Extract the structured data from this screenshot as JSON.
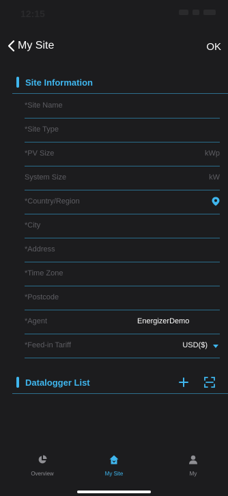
{
  "status": {
    "time": "12:15"
  },
  "nav": {
    "back_label": "My Site",
    "ok_label": "OK"
  },
  "site_info": {
    "title": "Site Information",
    "fields": {
      "site_name": {
        "label": "*Site Name"
      },
      "site_type": {
        "label": "*Site Type"
      },
      "pv_size": {
        "label": "*PV Size",
        "unit": "kWp"
      },
      "system_size": {
        "label": "System Size",
        "unit": "kW"
      },
      "country": {
        "label": "*Country/Region"
      },
      "city": {
        "label": "*City"
      },
      "address": {
        "label": "*Address"
      },
      "time_zone": {
        "label": "*Time Zone"
      },
      "postcode": {
        "label": "*Postcode"
      },
      "agent": {
        "label": "*Agent",
        "value": "EnergizerDemo"
      },
      "feed_in": {
        "label": "*Feed-in Tariff",
        "value": "USD($)"
      }
    }
  },
  "datalogger": {
    "title": "Datalogger List"
  },
  "tabs": {
    "overview": "Overview",
    "mysite": "My Site",
    "my": "My"
  },
  "colors": {
    "accent": "#3fb6ee",
    "background": "#1c1c1e",
    "muted": "#5d5d62"
  }
}
